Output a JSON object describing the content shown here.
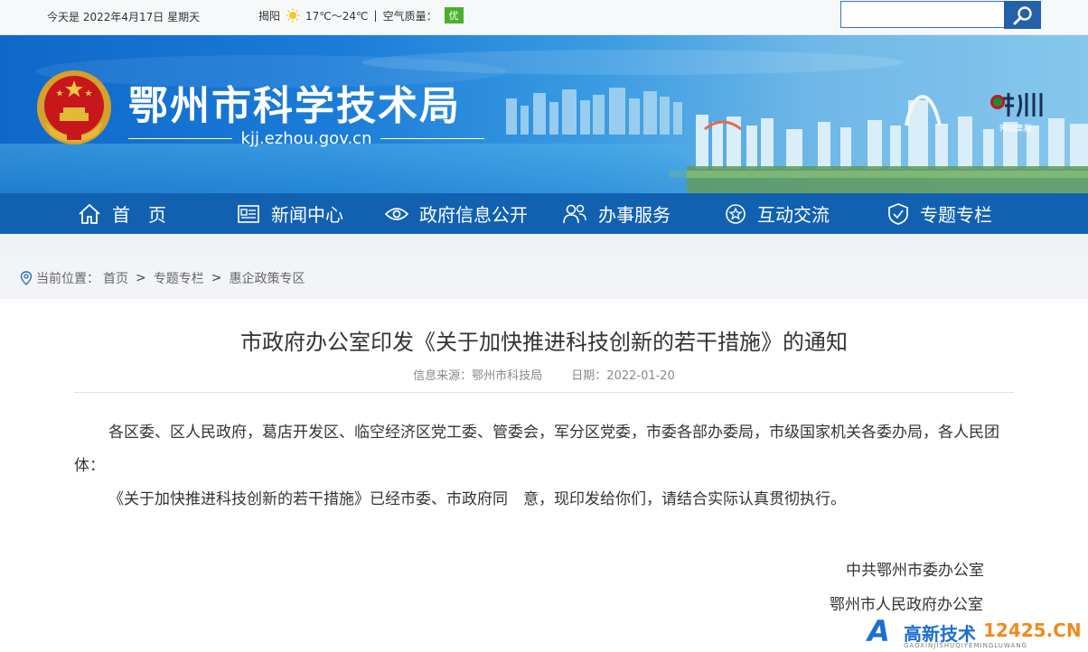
{
  "topbar": {
    "date": "今天是 2022年4月17日 星期天",
    "city": "揭阳",
    "temperature": "17℃～24℃",
    "air_label": "空气质量：",
    "air_value": "优",
    "search_placeholder": "",
    "colors": {
      "aqi": "#4caf2b",
      "search_button": "#2361a8"
    }
  },
  "banner": {
    "title": "鄂州市科学技术局",
    "url": "kjj.ezhou.gov.cn",
    "logo_text": "鄂州",
    "logo_sub": "网站集群"
  },
  "nav": {
    "items": [
      {
        "label": "首　页",
        "icon": "home-icon"
      },
      {
        "label": "新闻中心",
        "icon": "newspaper-icon"
      },
      {
        "label": "政府信息公开",
        "icon": "eye-icon"
      },
      {
        "label": "办事服务",
        "icon": "people-icon"
      },
      {
        "label": "互动交流",
        "icon": "star-badge-icon"
      },
      {
        "label": "专题专栏",
        "icon": "shield-icon"
      }
    ],
    "color": "#1261b1"
  },
  "breadcrumb": {
    "prefix": "当前位置：",
    "items": [
      "首页",
      "专题专栏",
      "惠企政策专区"
    ],
    "separator": ">"
  },
  "article": {
    "title": "市政府办公室印发《关于加快推进科技创新的若干措施》的通知",
    "source": "信息来源：鄂州市科技局",
    "date": "日期：2022-01-20",
    "paragraphs": [
      "各区委、区人民政府，葛店开发区、临空经济区党工委、管委会，军分区党委，市委各部办委局，市级国家机关各委办局，各人民团体：",
      "《关于加快推进科技创新的若干措施》已经市委、市政府同　意，现印发给你们，请结合实际认真贯彻执行。"
    ],
    "signatures": [
      "中共鄂州市委办公室",
      "鄂州市人民政府办公室"
    ]
  },
  "watermark": {
    "letter": "A",
    "text": "高新技术",
    "num": "12425.CN",
    "sub": "GAOXINJISHUQIYEMINGLUWANG"
  }
}
